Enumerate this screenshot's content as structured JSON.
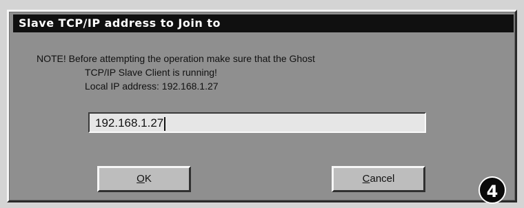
{
  "dialog": {
    "title": "Slave TCP/IP address to Join to",
    "note_line1": "NOTE! Before attempting the operation make sure that the Ghost",
    "note_line2": "TCP/IP Slave Client is running!",
    "note_line3": "Local IP address: 192.168.1.27",
    "ip_input_value": "192.168.1.27",
    "ok_label_first": "O",
    "ok_label_rest": "K",
    "cancel_label_first": "C",
    "cancel_label_rest": "ancel"
  },
  "badge": {
    "step_number": "4"
  }
}
